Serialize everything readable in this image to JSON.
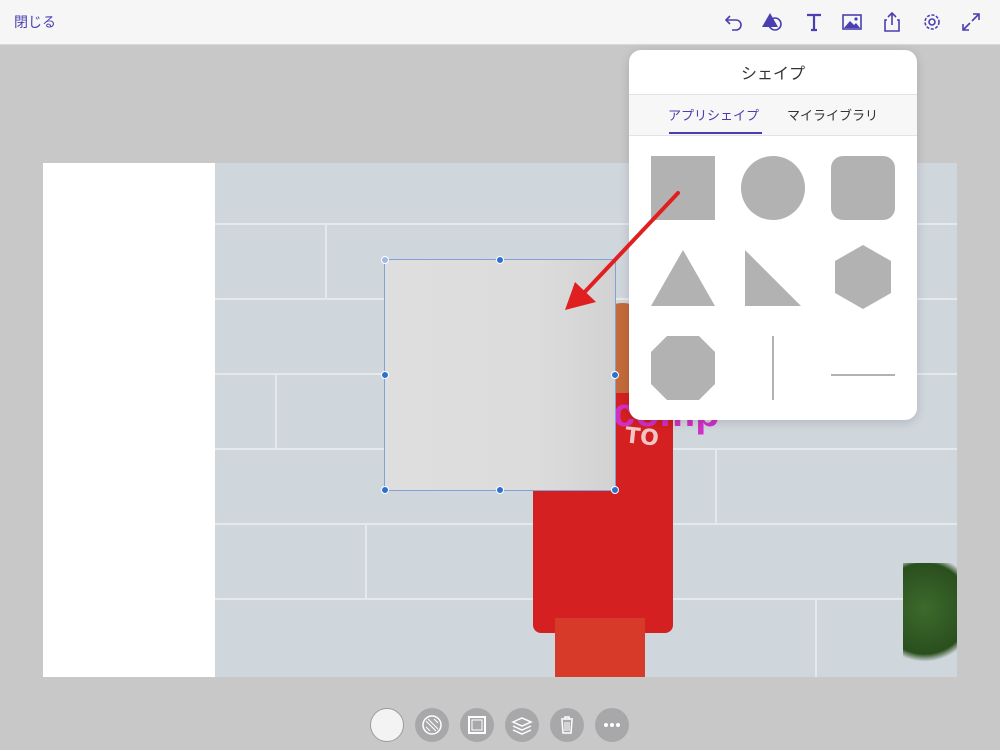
{
  "topbar": {
    "close_label": "閉じる",
    "tools": [
      "undo-icon",
      "shapes-icon",
      "text-icon",
      "image-icon",
      "share-icon",
      "settings-icon",
      "fullscreen-icon"
    ]
  },
  "popover": {
    "title": "シェイプ",
    "tabs": [
      {
        "label": "アプリシェイプ",
        "active": true
      },
      {
        "label": "マイライブラリ",
        "active": false
      }
    ],
    "shapes": [
      "square",
      "circle",
      "rounded-square",
      "triangle",
      "right-triangle",
      "hexagon",
      "octagon",
      "vertical-line",
      "horizontal-line"
    ]
  },
  "canvas": {
    "overlay_text": "comp",
    "shirt_text": "TO"
  },
  "bottom_toolbar": {
    "tools": [
      "fill-color-icon",
      "opacity-icon",
      "border-icon",
      "layers-icon",
      "delete-icon",
      "more-icon"
    ]
  },
  "colors": {
    "accent": "#4a3fb1",
    "shape_fill": "#b2b2b2",
    "selection": "#2f6fd1",
    "arrow": "#e02020"
  }
}
